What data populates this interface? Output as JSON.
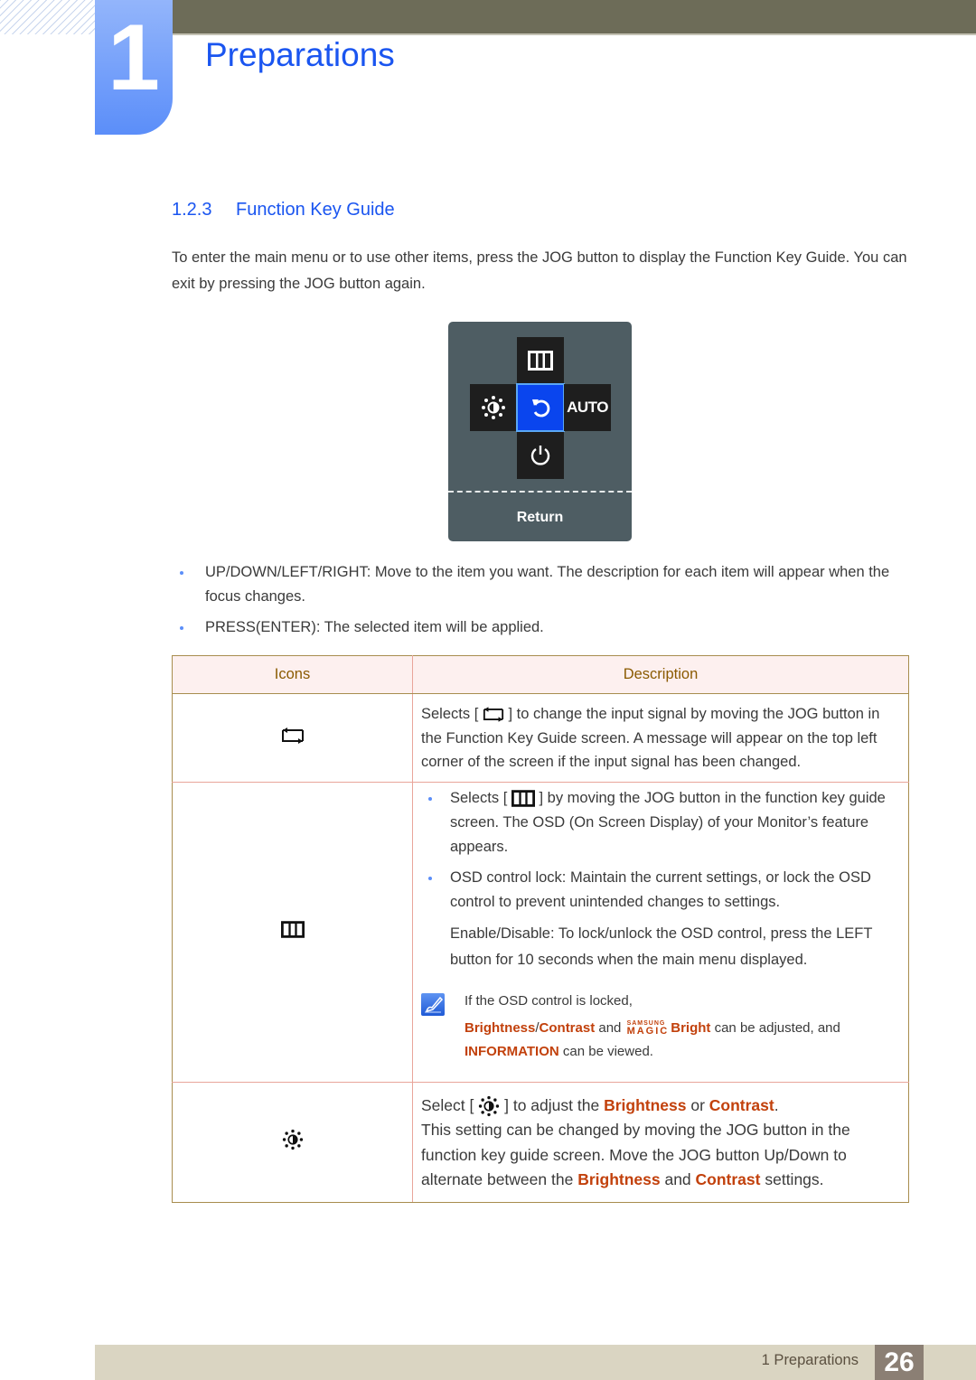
{
  "header": {
    "chapter_number": "1",
    "chapter_title": "Preparations"
  },
  "section": {
    "number": "1.2.3",
    "title": "Function Key Guide",
    "intro": "To enter the main menu or to use other items, press the JOG button to display the Function Key Guide. You can exit by pressing the JOG button again."
  },
  "osd": {
    "buttons": [
      {
        "position": "up",
        "icon": "menu-icon"
      },
      {
        "position": "left",
        "icon": "brightness-icon"
      },
      {
        "position": "center",
        "icon": "return-icon",
        "active": true
      },
      {
        "position": "right",
        "label": "AUTO"
      },
      {
        "position": "down",
        "icon": "power-icon"
      }
    ],
    "auto_label": "AUTO",
    "footer_label": "Return",
    "active_color": "#0a45ee"
  },
  "bullets": [
    "UP/DOWN/LEFT/RIGHT: Move to the item you want. The description for each item will appear when the focus changes.",
    "PRESS(ENTER): The selected item will be applied."
  ],
  "table": {
    "headers": {
      "icons": "Icons",
      "description": "Description"
    },
    "rows": [
      {
        "icon": "source-icon",
        "desc_pre": "Selects [",
        "desc_post": "] to change the input signal by moving the JOG button in the Function Key Guide screen. A message will appear on the top left corner of the screen if the input signal has been changed."
      },
      {
        "icon": "menu-icon",
        "bullet1_pre": "Selects [",
        "bullet1_post": "] by moving the JOG button in the function key guide screen. The OSD (On Screen Display) of your Monitor’s feature appears.",
        "bullet2": "OSD control lock: Maintain the current settings, or lock the OSD control to prevent unintended changes to settings.",
        "sub": "Enable/Disable: To lock/unlock the OSD control, press the LEFT button for 10 seconds when the main menu displayed.",
        "note": {
          "line1": "If the OSD control is locked,",
          "brightness": "Brightness",
          "slash": "/",
          "contrast": "Contrast",
          "and": " and ",
          "magic_top": "SAMSUNG",
          "magic_bottom": "MAGIC",
          "bright": "Bright",
          "mid": " can be adjusted, and",
          "information": "INFORMATION",
          "end": " can be viewed."
        }
      },
      {
        "icon": "brightness-icon",
        "l1_pre": "Select [",
        "l1_mid": "] to adjust the ",
        "brightness": "Brightness",
        "or": " or ",
        "contrast": "Contrast",
        "period": ".",
        "l2": "This setting can be changed by moving the JOG button in the function key guide screen. Move the JOG button Up/Down to alternate between the ",
        "and": " and ",
        "end": " settings."
      }
    ]
  },
  "footer": {
    "section_label": "1 Preparations",
    "page_number": "26"
  },
  "colors": {
    "heading_blue": "#1a55f0",
    "highlight_orange": "#c2410c",
    "table_header_text": "#8a5a00",
    "table_header_bg": "#fdf0ef"
  }
}
